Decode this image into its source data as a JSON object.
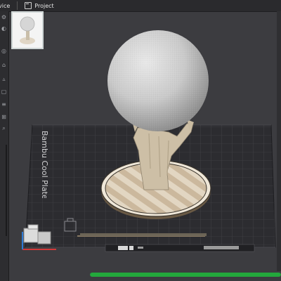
{
  "topbar": {
    "device_tab": "vice",
    "project_tab": "Project"
  },
  "left_toolbar": {
    "tools": [
      "settings-icon",
      "camera-icon",
      "target-icon",
      "home-icon",
      "filter-icon",
      "box-icon",
      "list-icon",
      "grid-icon",
      "search-icon"
    ]
  },
  "plate": {
    "label": "Bambu Cool Plate"
  },
  "progress": {
    "value": 1.0
  },
  "colors": {
    "accent": "#23a83c",
    "background": "#3b3b3f",
    "plate": "#2b2b2e",
    "brand_text": "#d4d4d6"
  }
}
